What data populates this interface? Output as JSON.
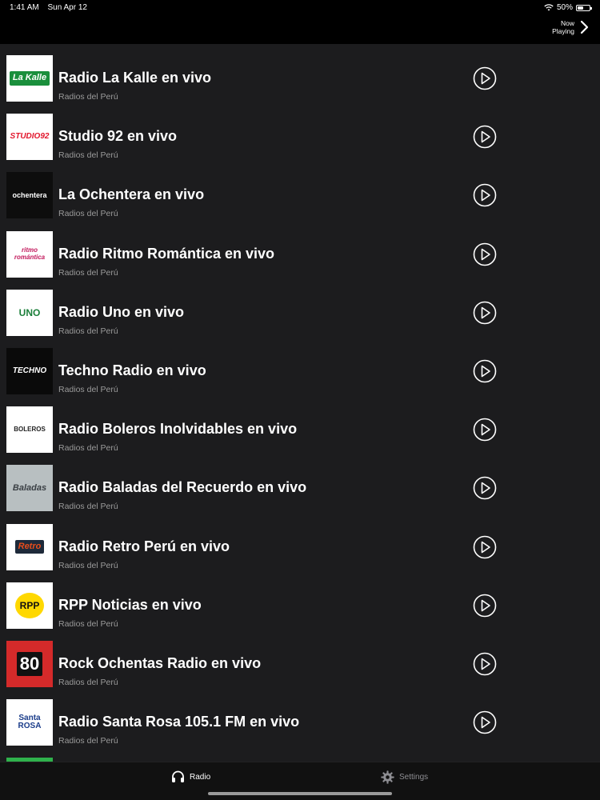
{
  "status": {
    "time": "1:41 AM",
    "date": "Sun Apr 12",
    "battery": "50%",
    "battery_level": 0.5
  },
  "nav": {
    "now_playing_line1": "Now",
    "now_playing_line2": "Playing"
  },
  "stations": [
    {
      "title": "Radio La Kalle en vivo",
      "subtitle": "Radios del Perú",
      "logo": "La Kalle"
    },
    {
      "title": "Studio 92 en vivo",
      "subtitle": "Radios del Perú",
      "logo": "STUDIO92"
    },
    {
      "title": "La Ochentera en vivo",
      "subtitle": "Radios del Perú",
      "logo": "ochentera"
    },
    {
      "title": "Radio Ritmo Romántica en vivo",
      "subtitle": "Radios del Perú",
      "logo": "ritmo romántica"
    },
    {
      "title": "Radio Uno en vivo",
      "subtitle": "Radios del Perú",
      "logo": "UNO"
    },
    {
      "title": "Techno Radio en vivo",
      "subtitle": "Radios del Perú",
      "logo": "TECHNO"
    },
    {
      "title": "Radio Boleros Inolvidables en vivo",
      "subtitle": "Radios del Perú",
      "logo": "BOLEROS"
    },
    {
      "title": "Radio Baladas del Recuerdo en vivo",
      "subtitle": "Radios del Perú",
      "logo": "Baladas"
    },
    {
      "title": "Radio Retro Perú en vivo",
      "subtitle": "Radios del Perú",
      "logo": "Retro"
    },
    {
      "title": "RPP Noticias en vivo",
      "subtitle": "Radios del Perú",
      "logo": "RPP"
    },
    {
      "title": "Rock Ochentas Radio en vivo",
      "subtitle": "Radios del Perú",
      "logo": "80"
    },
    {
      "title": "Radio Santa Rosa 105.1 FM en vivo",
      "subtitle": "Radios del Perú",
      "logo": "Santa ROSA"
    }
  ],
  "tabs": {
    "radio": "Radio",
    "settings": "Settings"
  },
  "colors": {
    "background": "#1c1c1e",
    "subtitle": "#9a9a9a",
    "tab_inactive": "#8e8e93"
  }
}
